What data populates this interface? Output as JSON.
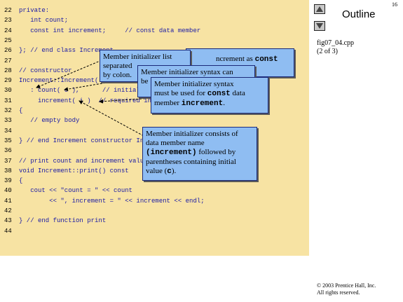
{
  "slide_number": "16",
  "outline_label": "Outline",
  "file_info": [
    "fig07_04.cpp",
    "(2 of 3)"
  ],
  "copyright": [
    "© 2003 Prentice Hall, Inc.",
    "All rights reserved."
  ],
  "code_lines": [
    {
      "num": "22",
      "text": "private:"
    },
    {
      "num": "23",
      "text": "   int count;"
    },
    {
      "num": "24",
      "text": "   const int increment;     // const data member"
    },
    {
      "num": "25",
      "text": ""
    },
    {
      "num": "26",
      "text": "}; // end class Increment"
    },
    {
      "num": "27",
      "text": ""
    },
    {
      "num": "28",
      "text": "// constructor"
    },
    {
      "num": "29",
      "text": "Increment::Increment( int c, int i )"
    },
    {
      "num": "30",
      "text": "   : count( c ),      // initializer for non-const member"
    },
    {
      "num": "31",
      "text": "     increment( i )  // required initializer for const member"
    },
    {
      "num": "32",
      "text": "{"
    },
    {
      "num": "33",
      "text": "   // empty body"
    },
    {
      "num": "34",
      "text": ""
    },
    {
      "num": "35",
      "text": "} // end Increment constructor Increment"
    },
    {
      "num": "36",
      "text": ""
    },
    {
      "num": "37",
      "text": "// print count and increment values"
    },
    {
      "num": "38",
      "text": "void Increment::print() const"
    },
    {
      "num": "39",
      "text": "{"
    },
    {
      "num": "40",
      "text": "   cout << \"count = \" << count"
    },
    {
      "num": "41",
      "text": "        << \", increment = \" << increment << endl;"
    },
    {
      "num": "42",
      "text": ""
    },
    {
      "num": "43",
      "text": "} // end function print"
    },
    {
      "num": "44",
      "text": ""
    }
  ],
  "callouts": {
    "c1": {
      "a": "Member initializer list",
      "b": "separated",
      "c": "by colon."
    },
    "c1_tail": {
      "a": "ncrement as ",
      "b": "const"
    },
    "c2": {
      "a": "Member initializer syntax can",
      "b": "be"
    },
    "c3": {
      "a": "Member initializer syntax",
      "b": "must be used for ",
      "c": "const",
      "d": " data",
      "e": "member ",
      "f": "increment",
      "g": "."
    },
    "c4": {
      "a": "Member initializer consists of",
      "b": "data member name",
      "c": "(increment)",
      "d": " followed by",
      "e": "parentheses containing initial",
      "f": "value (",
      "g": "c",
      "h": ")."
    }
  }
}
